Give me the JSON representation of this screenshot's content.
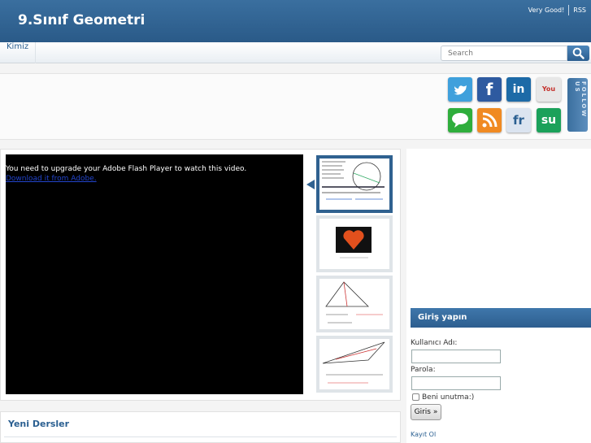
{
  "site": {
    "title": "9.Sınıf Geometri"
  },
  "top_links": [
    "Very Good!",
    "RSS"
  ],
  "nav": {
    "items": [
      "Kimiz"
    ]
  },
  "search": {
    "placeholder": "Search"
  },
  "social": {
    "icons": [
      {
        "name": "twitter-icon",
        "label": "t",
        "color": "#3fa0dc"
      },
      {
        "name": "facebook-icon",
        "label": "f",
        "color": "#2e5aa0"
      },
      {
        "name": "linkedin-icon",
        "label": "in",
        "color": "#1d6aa7"
      },
      {
        "name": "youtube-icon",
        "label": "You",
        "color": "#e7e7e7"
      },
      {
        "name": "chat-icon",
        "label": "",
        "color": "#2fae3c"
      },
      {
        "name": "rss-icon",
        "label": "",
        "color": "#f08a22"
      },
      {
        "name": "friendfeed-icon",
        "label": "fr",
        "color": "#dbe4f0"
      },
      {
        "name": "stumbleupon-icon",
        "label": "su",
        "color": "#1ba15a"
      }
    ],
    "follow_label": "FOLLOW US"
  },
  "video": {
    "message": "You need to upgrade your Adobe Flash Player to watch this video.",
    "link_text": "Download it from Adobe."
  },
  "lessons": {
    "title": "Yeni Dersler"
  },
  "login": {
    "title": "Giriş yapın",
    "username_label": "Kullanıcı Adı:",
    "password_label": "Parola:",
    "remember_label": "Beni unutma:)",
    "button_label": "Giris »",
    "register_label": "Kayıt Ol"
  }
}
